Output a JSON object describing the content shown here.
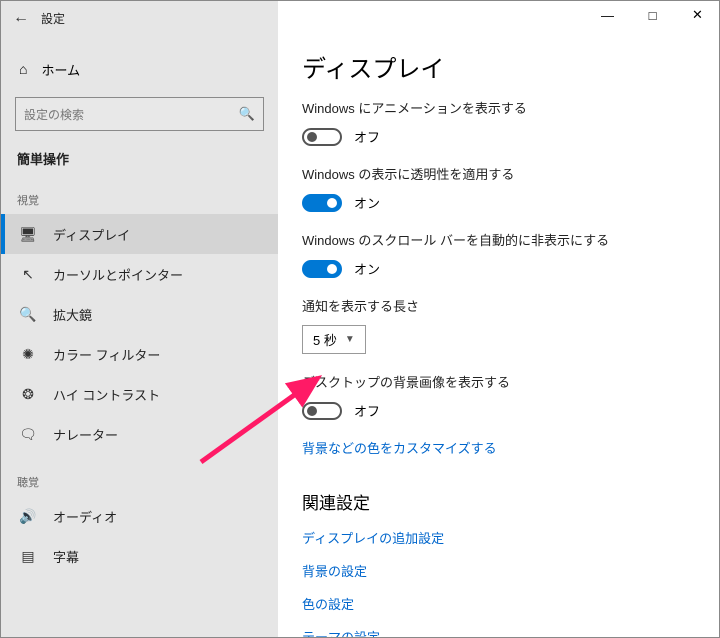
{
  "titlebar": {
    "title": "設定"
  },
  "home": {
    "label": "ホーム"
  },
  "search": {
    "placeholder": "設定の検索"
  },
  "category": "簡単操作",
  "sections": {
    "visual": {
      "header": "視覚",
      "items": [
        {
          "label": "ディスプレイ"
        },
        {
          "label": "カーソルとポインター"
        },
        {
          "label": "拡大鏡"
        },
        {
          "label": "カラー フィルター"
        },
        {
          "label": "ハイ コントラスト"
        },
        {
          "label": "ナレーター"
        }
      ]
    },
    "hearing": {
      "header": "聴覚",
      "items": [
        {
          "label": "オーディオ"
        },
        {
          "label": "字幕"
        }
      ]
    }
  },
  "main": {
    "title": "ディスプレイ",
    "settings": [
      {
        "label": "Windows にアニメーションを表示する",
        "state": "off",
        "stateLabel": "オフ"
      },
      {
        "label": "Windows の表示に透明性を適用する",
        "state": "on",
        "stateLabel": "オン"
      },
      {
        "label": "Windows のスクロール バーを自動的に非表示にする",
        "state": "on",
        "stateLabel": "オン"
      }
    ],
    "notifDuration": {
      "label": "通知を表示する長さ",
      "value": "5 秒"
    },
    "desktopBg": {
      "label": "デスクトップの背景画像を表示する",
      "state": "off",
      "stateLabel": "オフ"
    },
    "customizeLink": "背景などの色をカスタマイズする",
    "related": {
      "header": "関連設定",
      "links": [
        "ディスプレイの追加設定",
        "背景の設定",
        "色の設定",
        "テーマの設定"
      ]
    }
  }
}
